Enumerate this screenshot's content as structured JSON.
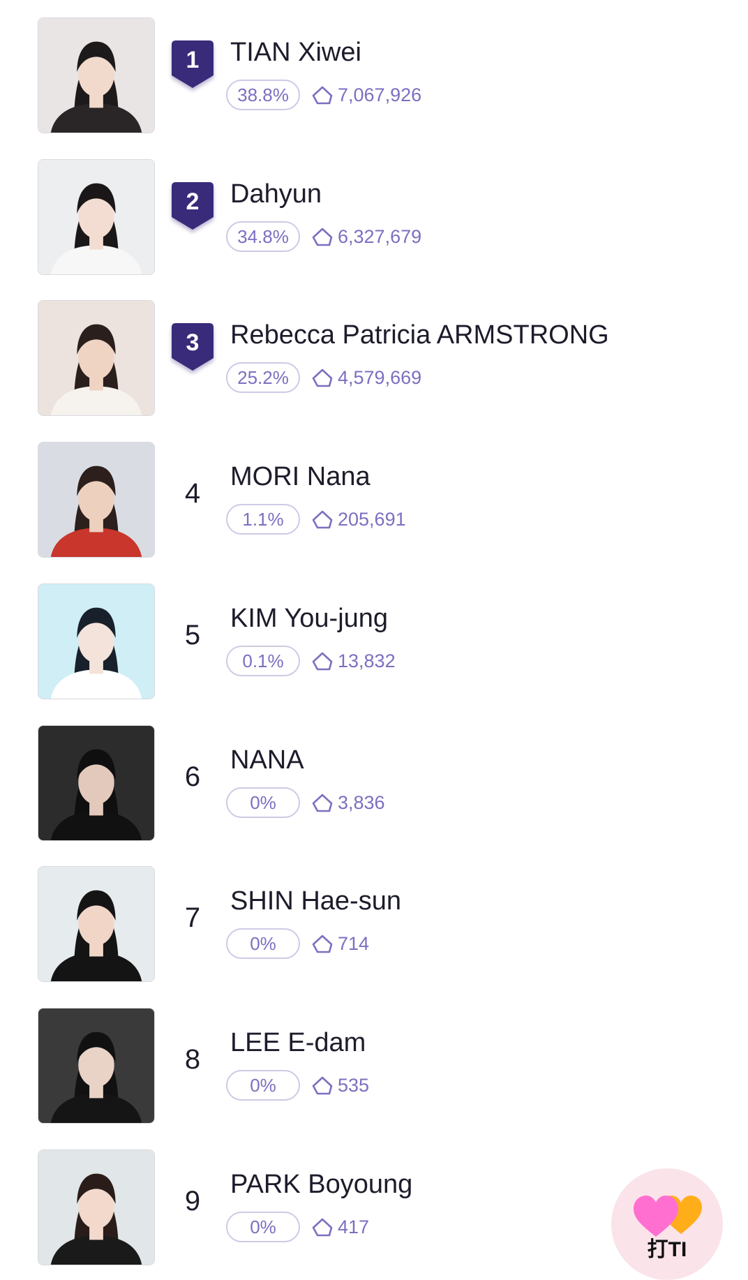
{
  "theme": {
    "accent": "#3a2a7a",
    "muted_purple": "#7c6fc0",
    "pill_border": "#cfc9e6",
    "fab_background": "#fbe3ea"
  },
  "ranking": {
    "entries": [
      {
        "rank": "1",
        "name": "TIAN Xiwei",
        "percent": "38.8%",
        "votes": "7,067,926",
        "badge": true,
        "photo_bg": "#e9e5e4",
        "hair": "#1d1a1c",
        "skin": "#f1d9cc",
        "top": "#2a2628"
      },
      {
        "rank": "2",
        "name": "Dahyun",
        "percent": "34.8%",
        "votes": "6,327,679",
        "badge": true,
        "photo_bg": "#edeef0",
        "hair": "#1b1718",
        "skin": "#f3ddd2",
        "top": "#f7f7f7"
      },
      {
        "rank": "3",
        "name": "Rebecca Patricia ARMSTRONG",
        "percent": "25.2%",
        "votes": "4,579,669",
        "badge": true,
        "photo_bg": "#ece2de",
        "hair": "#2a1f1d",
        "skin": "#efd3c3",
        "top": "#f6f2ee"
      },
      {
        "rank": "4",
        "name": "MORI Nana",
        "percent": "1.1%",
        "votes": "205,691",
        "badge": false,
        "photo_bg": "#d9dde3",
        "hair": "#2c1f1c",
        "skin": "#eed0bf",
        "top": "#c8362c"
      },
      {
        "rank": "5",
        "name": "KIM You-jung",
        "percent": "0.1%",
        "votes": "13,832",
        "badge": false,
        "photo_bg": "#cfeef6",
        "hair": "#18202c",
        "skin": "#f4e3da",
        "top": "#ffffff"
      },
      {
        "rank": "6",
        "name": "NANA",
        "percent": "0%",
        "votes": "3,836",
        "badge": false,
        "photo_bg": "#2c2c2c",
        "hair": "#0f0f10",
        "skin": "#e3c9bb",
        "top": "#111111"
      },
      {
        "rank": "7",
        "name": "SHIN Hae-sun",
        "percent": "0%",
        "votes": "714",
        "badge": false,
        "photo_bg": "#e6ebee",
        "hair": "#151414",
        "skin": "#f1d6c8",
        "top": "#141414"
      },
      {
        "rank": "8",
        "name": "LEE E-dam",
        "percent": "0%",
        "votes": "535",
        "badge": false,
        "photo_bg": "#3a3a3a",
        "hair": "#111111",
        "skin": "#e9d2c6",
        "top": "#151515"
      },
      {
        "rank": "9",
        "name": "PARK Boyoung",
        "percent": "0%",
        "votes": "417",
        "badge": false,
        "photo_bg": "#e1e6e8",
        "hair": "#2a1d19",
        "skin": "#f2d9cc",
        "top": "#1a1a1a"
      }
    ]
  },
  "fab": {
    "label": "打TI",
    "icon": "hearts-icon",
    "heart_colors": [
      "#ff6fd0",
      "#ffae1a"
    ]
  }
}
